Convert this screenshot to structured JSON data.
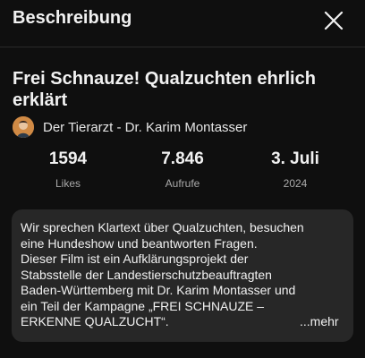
{
  "header": {
    "title": "Beschreibung",
    "close_icon": "close-icon"
  },
  "video": {
    "title_line1": "Frei Schnauze! Qualzuchten ehrlich",
    "title_line2": "erklärt",
    "channel": "Der Tierarzt - Dr. Karim Montasser"
  },
  "stats": [
    {
      "value": "1594",
      "label": "Likes"
    },
    {
      "value": "7.846",
      "label": "Aufrufe"
    },
    {
      "value": "3. Juli",
      "label": "2024"
    }
  ],
  "description": {
    "lines": [
      "Wir sprechen Klartext über Qualzuchten, besuchen",
      "eine Hundeshow und beantworten Fragen.",
      "Dieser Film ist ein Aufklärungsprojekt der",
      "Stabsstelle der Landestierschutzbeauftragten",
      "Baden-Württemberg mit Dr. Karim Montasser und",
      "ein Teil der Kampagne „FREI SCHNAUZE –",
      "ERKENNE QUALZUCHT“."
    ],
    "more_label": "...mehr"
  },
  "colors": {
    "background": "#0f0f0f",
    "card": "#272727",
    "text": "#f1f1f1",
    "secondary": "#aaaaaa"
  }
}
